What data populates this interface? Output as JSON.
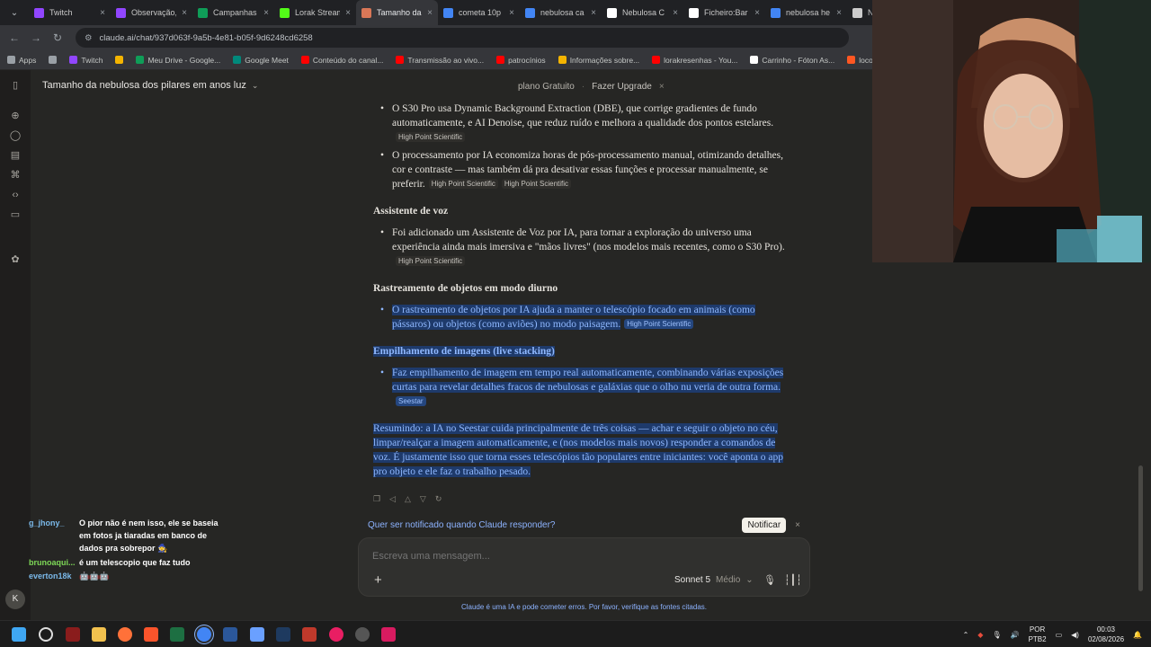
{
  "browser": {
    "tabs": [
      {
        "label": "Twitch",
        "color": "#9146ff"
      },
      {
        "label": "Observação,",
        "color": "#9146ff"
      },
      {
        "label": "Campanhas",
        "color": "#0f9d58"
      },
      {
        "label": "Lorak Stream",
        "color": "#53fc18"
      },
      {
        "label": "Tamanho da",
        "color": "#d97757",
        "active": true
      },
      {
        "label": "cometa 10p",
        "color": "#4285f4"
      },
      {
        "label": "nebulosa ca",
        "color": "#4285f4"
      },
      {
        "label": "Nebulosa C",
        "color": "#ffffff"
      },
      {
        "label": "Ficheiro:Bar",
        "color": "#ffffff"
      },
      {
        "label": "nebulosa he",
        "color": "#4285f4"
      },
      {
        "label": "No",
        "color": "#cccccc"
      }
    ],
    "url": "claude.ai/chat/937d063f-9a5b-4e81-b05f-9d6248cd6258",
    "bookmarks": [
      {
        "label": "Apps",
        "color": "#9aa0a6"
      },
      {
        "label": "",
        "color": "#9aa0a6"
      },
      {
        "label": "Twitch",
        "color": "#9146ff"
      },
      {
        "label": "",
        "color": "#f4b400"
      },
      {
        "label": "Meu Drive - Google...",
        "color": "#0f9d58"
      },
      {
        "label": "Google Meet",
        "color": "#00897b"
      },
      {
        "label": "Conteúdo do canal...",
        "color": "#ff0000"
      },
      {
        "label": "Transmissão ao vivo...",
        "color": "#ff0000"
      },
      {
        "label": "patrocínios",
        "color": "#ff0000"
      },
      {
        "label": "Informações sobre...",
        "color": "#f4b400"
      },
      {
        "label": "lorakresenhas - You...",
        "color": "#ff0000"
      },
      {
        "label": "Carrinho - Fóton As...",
        "color": "#ffffff"
      },
      {
        "label": "loco",
        "color": "#ff5722"
      },
      {
        "label": "Det",
        "color": "#4285f4"
      }
    ]
  },
  "claude": {
    "chat_title": "Tamanho da nebulosa dos pilares em anos luz",
    "plan_label": "plano Gratuito",
    "upgrade_label": "Fazer Upgrade",
    "banner_close": "×",
    "bullets_top": [
      {
        "text": "O S30 Pro usa Dynamic Background Extraction (DBE), que corrige gradientes de fundo automaticamente, e AI Denoise, que reduz ruído e melhora a qualidade dos pontos estelares.",
        "cites": [
          "High Point Scientific"
        ]
      },
      {
        "text": "O processamento por IA economiza horas de pós-processamento manual, otimizando detalhes, cor e contraste — mas também dá pra desativar essas funções e processar manualmente, se preferir.",
        "cites": [
          "High Point Scientific",
          "High Point Scientific"
        ]
      }
    ],
    "h_voice": "Assistente de voz",
    "voice_bullet": {
      "text": "Foi adicionado um Assistente de Voz por IA, para tornar a exploração do universo uma experiência ainda mais imersiva e \"mãos livres\" (nos modelos mais recentes, como o S30 Pro).",
      "cite": "High Point Scientific"
    },
    "h_tracking": "Rastreamento de objetos em modo diurno",
    "tracking_bullet": {
      "text": "O rastreamento de objetos por IA ajuda a manter o telescópio focado em animais (como pássaros) ou objetos (como aviões) no modo paisagem.",
      "cite": "High Point Scientific"
    },
    "h_stacking": "Empilhamento de imagens (live stacking)",
    "stacking_bullet": {
      "text": "Faz empilhamento de imagem em tempo real automaticamente, combinando várias exposições curtas para revelar detalhes fracos de nebulosas e galáxias que o olho nu veria de outra forma.",
      "cite": "Seestar"
    },
    "summary": "Resumindo: a IA no Seestar cuida principalmente de três coisas — achar e seguir o objeto no céu, limpar/realçar a imagem automaticamente, e (nos modelos mais novos) responder a comandos de voz. É justamente isso que torna esses telescópios tão populares entre iniciantes: você aponta o app pro objeto e ele faz o trabalho pesado.",
    "notify_text": "Quer ser notificado quando Claude responder?",
    "notify_button": "Notificar",
    "composer_placeholder": "Escreva uma mensagem...",
    "model": "Sonnet 5",
    "effort": "Médio",
    "disclaimer": "Claude é uma IA e pode cometer erros. Por favor, verifique as fontes citadas."
  },
  "twitch_chat": [
    {
      "user": "g_jhony_",
      "user_color": "#7ab8e8",
      "message": "O pior não é nem isso, ele se baseia em fotos ja tiaradas em banco de dados pra sobrepor 🧙"
    },
    {
      "user": "brunoaqui...",
      "user_color": "#7ed957",
      "message": "é um telescopio que faz tudo"
    },
    {
      "user": "everton18k",
      "user_color": "#7ab8e8",
      "message": "🤖🤖🤖"
    }
  ],
  "avatar_letter": "K",
  "taskbar": {
    "lang_line1": "POR",
    "lang_line2": "PTB2",
    "time": "00:03",
    "date": "02/08/2026"
  }
}
